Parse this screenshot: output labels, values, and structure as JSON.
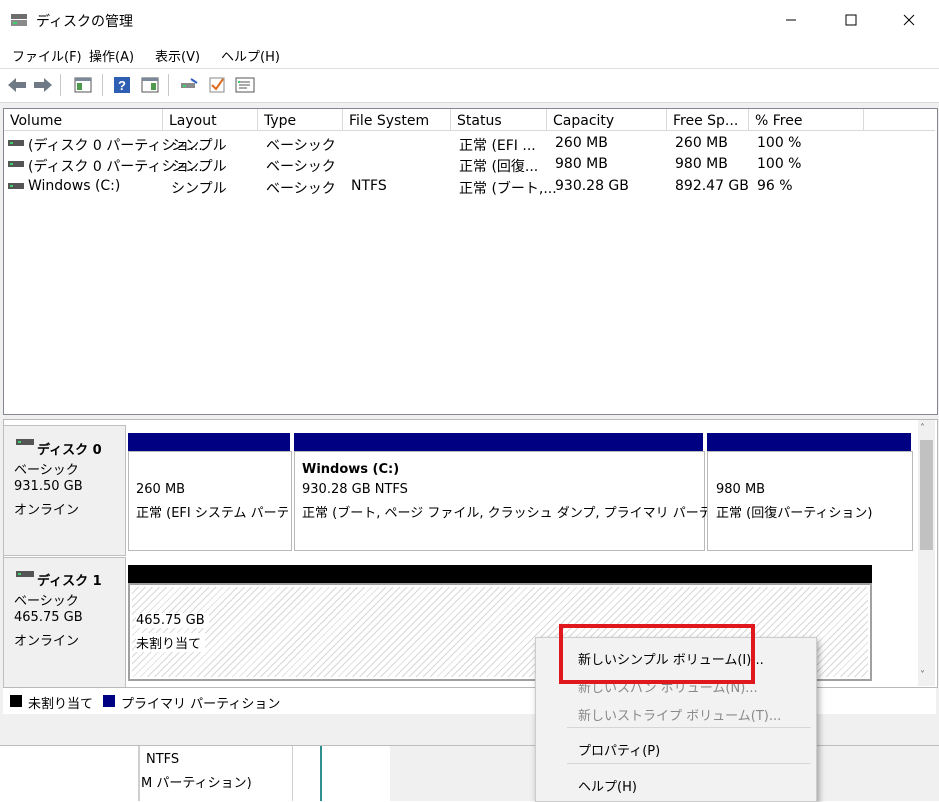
{
  "window": {
    "title": "ディスクの管理",
    "minimize_icon": "minimize-icon",
    "maximize_icon": "maximize-icon",
    "close_icon": "close-icon"
  },
  "menu": [
    "ファイル(F)",
    "操作(A)",
    "表示(V)",
    "ヘルプ(H)"
  ],
  "toolbar": {
    "icons": [
      "back-icon",
      "forward-icon",
      "console-tree-icon",
      "help-icon",
      "action-pane-icon",
      "connect-icon",
      "check-icon",
      "properties-icon"
    ]
  },
  "volume_list": {
    "columns": [
      "Volume",
      "Layout",
      "Type",
      "File System",
      "Status",
      "Capacity",
      "Free Sp...",
      "% Free"
    ],
    "rows": [
      [
        "(ディスク 0 パーティショ...",
        "シンプル",
        "ベーシック",
        "",
        "正常 (EFI ...",
        "260 MB",
        "260 MB",
        "100 %"
      ],
      [
        "(ディスク 0 パーティショ...",
        "シンプル",
        "ベーシック",
        "",
        "正常 (回復...",
        "980 MB",
        "980 MB",
        "100 %"
      ],
      [
        "Windows (C:)",
        "シンプル",
        "ベーシック",
        "NTFS",
        "正常 (ブート,...",
        "930.28 GB",
        "892.47 GB",
        "96 %"
      ]
    ]
  },
  "disks": [
    {
      "name": "ディスク 0",
      "type": "ベーシック",
      "size": "931.50 GB",
      "state": "オンライン",
      "partitions": [
        {
          "title": "",
          "line1": "260 MB",
          "line2": "正常 (EFI システム パーティ"
        },
        {
          "title": "Windows  (C:)",
          "line1": "930.28 GB NTFS",
          "line2": "正常 (ブート, ページ ファイル, クラッシュ ダンプ, プライマリ パーティション)"
        },
        {
          "title": "",
          "line1": "980 MB",
          "line2": "正常 (回復パーティション)"
        }
      ]
    },
    {
      "name": "ディスク 1",
      "type": "ベーシック",
      "size": "465.75 GB",
      "state": "オンライン",
      "partitions": [
        {
          "title": "",
          "line1": "465.75 GB",
          "line2": "未割り当て"
        }
      ]
    }
  ],
  "legend": [
    {
      "label": "未割り当て",
      "color": "#000000"
    },
    {
      "label": "プライマリ パーティション",
      "color": "#000082"
    }
  ],
  "context_menu": {
    "items": [
      {
        "label": "新しいシンプル ボリューム(I)...",
        "enabled": true
      },
      {
        "label": "新しいスパン ボリューム(N)...",
        "enabled": false
      },
      {
        "label": "新しいストライプ ボリューム(T)...",
        "enabled": false
      },
      {
        "label": "プロパティ(P)",
        "enabled": true
      },
      {
        "label": "ヘルプ(H)",
        "enabled": true
      }
    ],
    "highlight_color": "#e0181d"
  },
  "background_window": {
    "lines": [
      "NTFS",
      "M パーティション)"
    ]
  }
}
